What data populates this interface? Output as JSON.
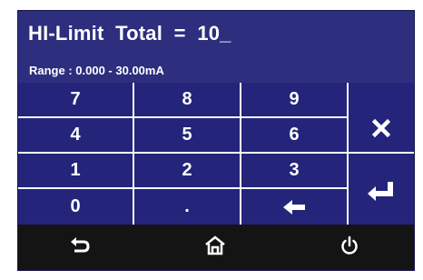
{
  "display": {
    "entry": "HI-Limit  Total  =  10_",
    "range": "Range : 0.000 - 30.00mA"
  },
  "keypad": {
    "digits": [
      "7",
      "8",
      "9",
      "4",
      "5",
      "6",
      "1",
      "2",
      "3",
      "0",
      "."
    ],
    "icons": {
      "clear": "close-icon",
      "backspace": "left-arrow-icon",
      "enter": "enter-return-icon"
    }
  },
  "footer": {
    "icons": [
      "back-icon",
      "home-icon",
      "power-icon"
    ]
  },
  "colors": {
    "screen_bg": "#22236a",
    "key_bg": "#23247a",
    "grid_lines": "#ffffff",
    "footer_bg": "#141414",
    "text": "#ffffff"
  }
}
